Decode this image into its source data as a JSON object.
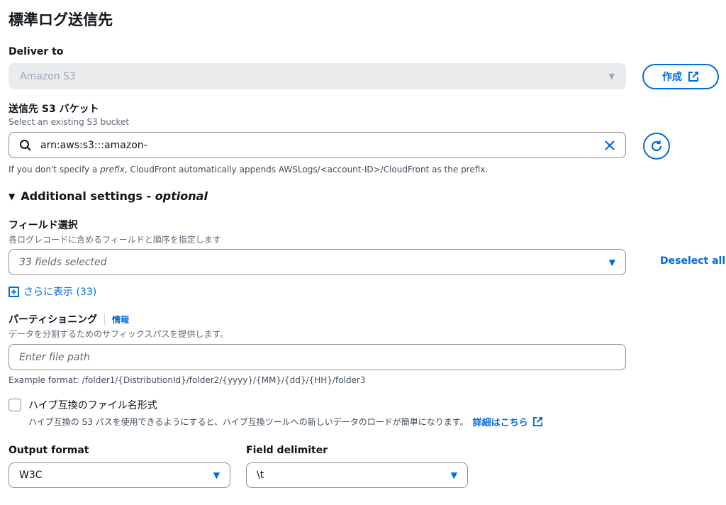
{
  "section_title": "標準ログ送信先",
  "deliver_to": {
    "label": "Deliver to",
    "value": "Amazon S3",
    "create_button": "作成"
  },
  "bucket": {
    "label": "送信先 S3 バケット",
    "description": "Select an existing S3 bucket",
    "value": "arn:aws:s3:::amazon-",
    "hint_prefix": "If you don't specify a ",
    "hint_italic": "prefix",
    "hint_suffix": ", CloudFront automatically appends AWSLogs/<account-ID>/CloudFront as the prefix."
  },
  "additional": {
    "title": "Additional settings - ",
    "optional": "optional"
  },
  "fields": {
    "label": "フィールド選択",
    "description": "各ログレコードに含めるフィールドと順序を指定します",
    "selected": "33 fields selected",
    "deselect_all": "Deselect all",
    "show_more": "さらに表示 (33)"
  },
  "partition": {
    "label": "パーティショニング",
    "info": "情報",
    "description": "データを分割するためのサフィックスパスを提供します。",
    "placeholder": "Enter file path",
    "example": "Example format: /folder1/{DistributionId}/folder2/{yyyy}/{MM}/{dd}/{HH}/folder3"
  },
  "hive": {
    "label": "ハイブ互換のファイル名形式",
    "description": "ハイブ互換の S3 パスを使用できるようにすると、ハイブ互換ツールへの新しいデータのロードが簡単になります。",
    "learn_more": "詳細はこちら"
  },
  "output_format": {
    "label": "Output format",
    "value": "W3C"
  },
  "field_delimiter": {
    "label": "Field delimiter",
    "value": "\\t"
  },
  "colors": {
    "accent": "#006ce0",
    "disabled_bg": "#e9ebed",
    "border": "#8c8c94"
  }
}
